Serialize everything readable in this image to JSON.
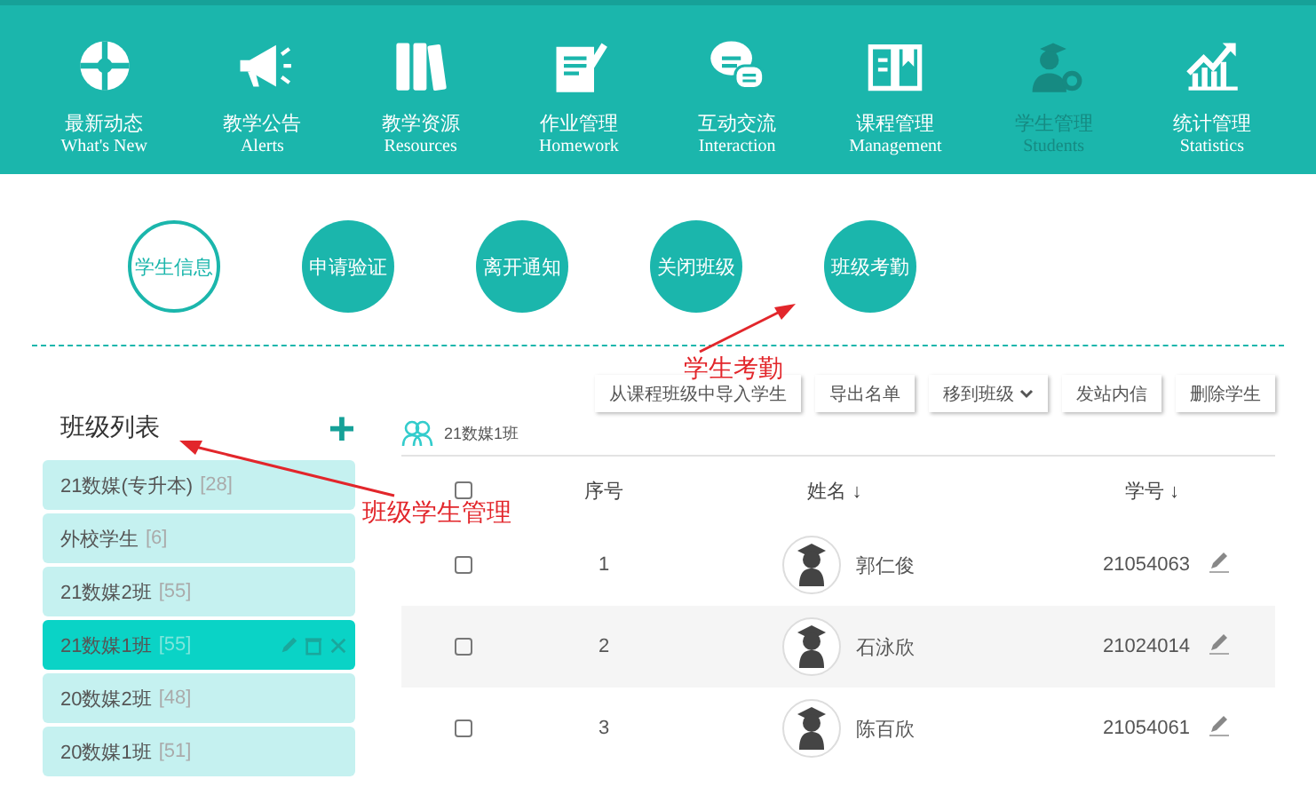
{
  "nav": [
    {
      "label": "最新动态",
      "sublabel": "What's New",
      "selected": false
    },
    {
      "label": "教学公告",
      "sublabel": "Alerts",
      "selected": false
    },
    {
      "label": "教学资源",
      "sublabel": "Resources",
      "selected": false
    },
    {
      "label": "作业管理",
      "sublabel": "Homework",
      "selected": false
    },
    {
      "label": "互动交流",
      "sublabel": "Interaction",
      "selected": false
    },
    {
      "label": "课程管理",
      "sublabel": "Management",
      "selected": false
    },
    {
      "label": "学生管理",
      "sublabel": "Students",
      "selected": true
    },
    {
      "label": "统计管理",
      "sublabel": "Statistics",
      "selected": false
    }
  ],
  "sub_tabs": [
    {
      "label": "学生信息",
      "selected": true
    },
    {
      "label": "申请验证",
      "selected": false
    },
    {
      "label": "离开通知",
      "selected": false
    },
    {
      "label": "关闭班级",
      "selected": false
    },
    {
      "label": "班级考勤",
      "selected": false
    }
  ],
  "class_list": {
    "title": "班级列表",
    "add": "+",
    "items": [
      {
        "name": "21数媒(专升本)",
        "count": "[28]",
        "selected": false
      },
      {
        "name": "外校学生",
        "count": "[6]",
        "selected": false
      },
      {
        "name": "21数媒2班",
        "count": "[55]",
        "selected": false
      },
      {
        "name": "21数媒1班",
        "count": "[55]",
        "selected": true
      },
      {
        "name": "20数媒2班",
        "count": "[48]",
        "selected": false
      },
      {
        "name": "20数媒1班",
        "count": "[51]",
        "selected": false
      }
    ]
  },
  "toolbar": [
    {
      "label": "从课程班级中导入学生",
      "kind": "button"
    },
    {
      "label": "导出名单",
      "kind": "button"
    },
    {
      "label": "移到班级",
      "kind": "dropdown"
    },
    {
      "label": "发站内信",
      "kind": "button"
    },
    {
      "label": "删除学生",
      "kind": "button"
    }
  ],
  "current_class": "21数媒1班",
  "table": {
    "all_checked": false,
    "columns": [
      "序号",
      "姓名 ↓",
      "学号 ↓"
    ],
    "rows": [
      {
        "checked": false,
        "index": "1",
        "name": "郭仁俊",
        "id": "21054063"
      },
      {
        "checked": false,
        "index": "2",
        "name": "石泳欣",
        "id": "21024014"
      },
      {
        "checked": false,
        "index": "3",
        "name": "陈百欣",
        "id": "21054061"
      }
    ]
  },
  "tab_annotation": "学生考勤",
  "list_annotation": "班级学生管理"
}
